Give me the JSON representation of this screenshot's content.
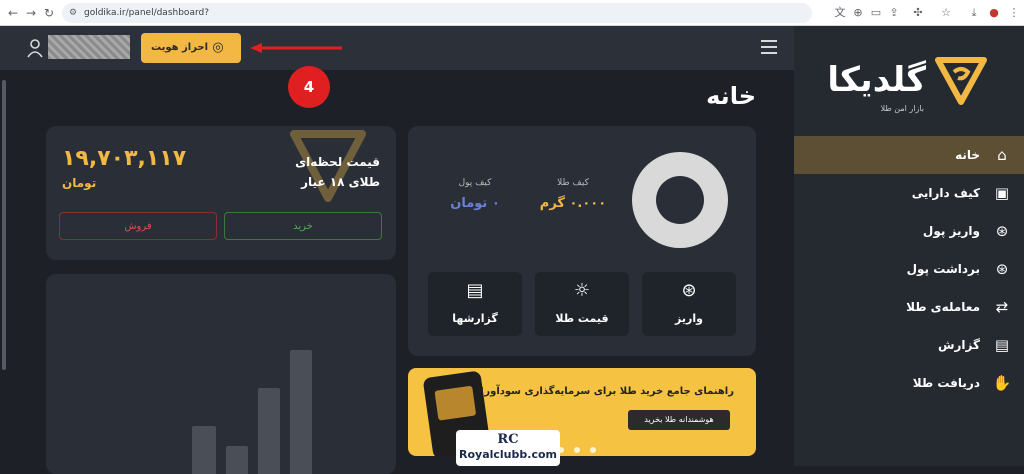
{
  "browser": {
    "url": "goldika.ir/panel/dashboard?"
  },
  "sidebar": {
    "logo_text": "گلدیکا",
    "logo_sub": "بازار امن طلا",
    "items": [
      {
        "label": "خانه",
        "icon": "home-icon",
        "active": true
      },
      {
        "label": "کیف دارایی",
        "icon": "wallet-icon",
        "active": false
      },
      {
        "label": "واریز پول",
        "icon": "money-in-icon",
        "active": false
      },
      {
        "label": "برداشت پول",
        "icon": "money-out-icon",
        "active": false
      },
      {
        "label": "معامله‌ی طلا",
        "icon": "trade-icon",
        "active": false
      },
      {
        "label": "گزارش",
        "icon": "report-icon",
        "active": false
      },
      {
        "label": "دریافت طلا",
        "icon": "receive-icon",
        "active": false
      }
    ]
  },
  "topbar": {
    "kyc_label": "احراز هویت",
    "annotation_number": "4"
  },
  "main": {
    "title": "خانه",
    "wallet": {
      "gold_label": "کیف طلا",
      "gold_value": "۰.۰۰۰ گرم",
      "money_label": "کیف پول",
      "money_value": "۰ تومان"
    },
    "tiles": [
      {
        "label": "واریز",
        "icon": "deposit-icon"
      },
      {
        "label": "قیمت طلا",
        "icon": "gold-price-icon"
      },
      {
        "label": "گزارشها",
        "icon": "reports-icon"
      }
    ],
    "price": {
      "title_line1": "قیمت لحظه‌ای",
      "title_line2": "طلای ۱۸ عیار",
      "value": "۱۹,۷۰۳,۱۱۷",
      "unit": "تومان",
      "buy_label": "خرید",
      "sell_label": "فروش"
    },
    "banner": {
      "text": "راهنمای جامع خرید طلا برای سرمایه‌گذاری سودآور!",
      "button": "هوشمندانه طلا بخرید"
    }
  },
  "watermark": {
    "logo": "RC",
    "site": "Royalclubb.com"
  },
  "colors": {
    "accent": "#f2b843",
    "sidebar_bg": "#252a31",
    "page_bg": "#1d2026",
    "card_bg": "#2a2f37",
    "active_item": "#5d4f33",
    "money_blue": "#6b7fd7",
    "annotation_red": "#e02020"
  }
}
